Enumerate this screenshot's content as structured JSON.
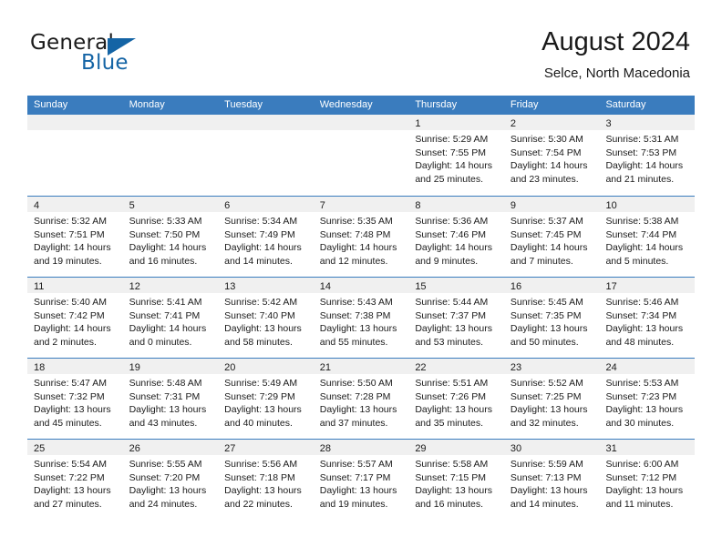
{
  "logo": {
    "word1": "General",
    "word2": "Blue",
    "accent_color": "#1464a5",
    "triangle": "triangle-icon"
  },
  "header": {
    "title": "August 2024",
    "subtitle": "Selce, North Macedonia"
  },
  "theme": {
    "header_blue": "#3a7cbe",
    "band_gray": "#f0f0f0",
    "text": "#1a1a1a"
  },
  "weekdays": [
    "Sunday",
    "Monday",
    "Tuesday",
    "Wednesday",
    "Thursday",
    "Friday",
    "Saturday"
  ],
  "weeks": [
    [
      {
        "day": "",
        "lines": []
      },
      {
        "day": "",
        "lines": []
      },
      {
        "day": "",
        "lines": []
      },
      {
        "day": "",
        "lines": []
      },
      {
        "day": "1",
        "lines": [
          "Sunrise: 5:29 AM",
          "Sunset: 7:55 PM",
          "Daylight: 14 hours",
          "and 25 minutes."
        ]
      },
      {
        "day": "2",
        "lines": [
          "Sunrise: 5:30 AM",
          "Sunset: 7:54 PM",
          "Daylight: 14 hours",
          "and 23 minutes."
        ]
      },
      {
        "day": "3",
        "lines": [
          "Sunrise: 5:31 AM",
          "Sunset: 7:53 PM",
          "Daylight: 14 hours",
          "and 21 minutes."
        ]
      }
    ],
    [
      {
        "day": "4",
        "lines": [
          "Sunrise: 5:32 AM",
          "Sunset: 7:51 PM",
          "Daylight: 14 hours",
          "and 19 minutes."
        ]
      },
      {
        "day": "5",
        "lines": [
          "Sunrise: 5:33 AM",
          "Sunset: 7:50 PM",
          "Daylight: 14 hours",
          "and 16 minutes."
        ]
      },
      {
        "day": "6",
        "lines": [
          "Sunrise: 5:34 AM",
          "Sunset: 7:49 PM",
          "Daylight: 14 hours",
          "and 14 minutes."
        ]
      },
      {
        "day": "7",
        "lines": [
          "Sunrise: 5:35 AM",
          "Sunset: 7:48 PM",
          "Daylight: 14 hours",
          "and 12 minutes."
        ]
      },
      {
        "day": "8",
        "lines": [
          "Sunrise: 5:36 AM",
          "Sunset: 7:46 PM",
          "Daylight: 14 hours",
          "and 9 minutes."
        ]
      },
      {
        "day": "9",
        "lines": [
          "Sunrise: 5:37 AM",
          "Sunset: 7:45 PM",
          "Daylight: 14 hours",
          "and 7 minutes."
        ]
      },
      {
        "day": "10",
        "lines": [
          "Sunrise: 5:38 AM",
          "Sunset: 7:44 PM",
          "Daylight: 14 hours",
          "and 5 minutes."
        ]
      }
    ],
    [
      {
        "day": "11",
        "lines": [
          "Sunrise: 5:40 AM",
          "Sunset: 7:42 PM",
          "Daylight: 14 hours",
          "and 2 minutes."
        ]
      },
      {
        "day": "12",
        "lines": [
          "Sunrise: 5:41 AM",
          "Sunset: 7:41 PM",
          "Daylight: 14 hours",
          "and 0 minutes."
        ]
      },
      {
        "day": "13",
        "lines": [
          "Sunrise: 5:42 AM",
          "Sunset: 7:40 PM",
          "Daylight: 13 hours",
          "and 58 minutes."
        ]
      },
      {
        "day": "14",
        "lines": [
          "Sunrise: 5:43 AM",
          "Sunset: 7:38 PM",
          "Daylight: 13 hours",
          "and 55 minutes."
        ]
      },
      {
        "day": "15",
        "lines": [
          "Sunrise: 5:44 AM",
          "Sunset: 7:37 PM",
          "Daylight: 13 hours",
          "and 53 minutes."
        ]
      },
      {
        "day": "16",
        "lines": [
          "Sunrise: 5:45 AM",
          "Sunset: 7:35 PM",
          "Daylight: 13 hours",
          "and 50 minutes."
        ]
      },
      {
        "day": "17",
        "lines": [
          "Sunrise: 5:46 AM",
          "Sunset: 7:34 PM",
          "Daylight: 13 hours",
          "and 48 minutes."
        ]
      }
    ],
    [
      {
        "day": "18",
        "lines": [
          "Sunrise: 5:47 AM",
          "Sunset: 7:32 PM",
          "Daylight: 13 hours",
          "and 45 minutes."
        ]
      },
      {
        "day": "19",
        "lines": [
          "Sunrise: 5:48 AM",
          "Sunset: 7:31 PM",
          "Daylight: 13 hours",
          "and 43 minutes."
        ]
      },
      {
        "day": "20",
        "lines": [
          "Sunrise: 5:49 AM",
          "Sunset: 7:29 PM",
          "Daylight: 13 hours",
          "and 40 minutes."
        ]
      },
      {
        "day": "21",
        "lines": [
          "Sunrise: 5:50 AM",
          "Sunset: 7:28 PM",
          "Daylight: 13 hours",
          "and 37 minutes."
        ]
      },
      {
        "day": "22",
        "lines": [
          "Sunrise: 5:51 AM",
          "Sunset: 7:26 PM",
          "Daylight: 13 hours",
          "and 35 minutes."
        ]
      },
      {
        "day": "23",
        "lines": [
          "Sunrise: 5:52 AM",
          "Sunset: 7:25 PM",
          "Daylight: 13 hours",
          "and 32 minutes."
        ]
      },
      {
        "day": "24",
        "lines": [
          "Sunrise: 5:53 AM",
          "Sunset: 7:23 PM",
          "Daylight: 13 hours",
          "and 30 minutes."
        ]
      }
    ],
    [
      {
        "day": "25",
        "lines": [
          "Sunrise: 5:54 AM",
          "Sunset: 7:22 PM",
          "Daylight: 13 hours",
          "and 27 minutes."
        ]
      },
      {
        "day": "26",
        "lines": [
          "Sunrise: 5:55 AM",
          "Sunset: 7:20 PM",
          "Daylight: 13 hours",
          "and 24 minutes."
        ]
      },
      {
        "day": "27",
        "lines": [
          "Sunrise: 5:56 AM",
          "Sunset: 7:18 PM",
          "Daylight: 13 hours",
          "and 22 minutes."
        ]
      },
      {
        "day": "28",
        "lines": [
          "Sunrise: 5:57 AM",
          "Sunset: 7:17 PM",
          "Daylight: 13 hours",
          "and 19 minutes."
        ]
      },
      {
        "day": "29",
        "lines": [
          "Sunrise: 5:58 AM",
          "Sunset: 7:15 PM",
          "Daylight: 13 hours",
          "and 16 minutes."
        ]
      },
      {
        "day": "30",
        "lines": [
          "Sunrise: 5:59 AM",
          "Sunset: 7:13 PM",
          "Daylight: 13 hours",
          "and 14 minutes."
        ]
      },
      {
        "day": "31",
        "lines": [
          "Sunrise: 6:00 AM",
          "Sunset: 7:12 PM",
          "Daylight: 13 hours",
          "and 11 minutes."
        ]
      }
    ]
  ]
}
